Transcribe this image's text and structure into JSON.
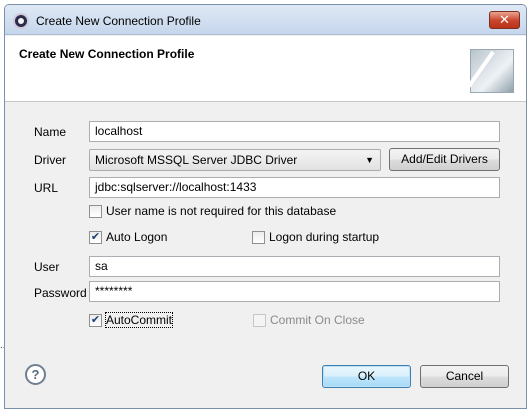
{
  "window": {
    "title": "Create New Connection Profile",
    "close_glyph": "✕"
  },
  "header": {
    "title": "Create New Connection Profile"
  },
  "form": {
    "name_label": "Name",
    "name_value": "localhost",
    "driver_label": "Driver",
    "driver_value": "Microsoft MSSQL Server JDBC Driver",
    "add_edit_drivers": "Add/Edit Drivers",
    "url_label": "URL",
    "url_value": "jdbc:sqlserver://localhost:1433",
    "username_not_required": {
      "label": "User name is not required for this database",
      "checked": false
    },
    "auto_logon": {
      "label": "Auto Logon",
      "checked": true
    },
    "logon_during_startup": {
      "label": "Logon during startup",
      "checked": false
    },
    "user_label": "User",
    "user_value": "sa",
    "password_label": "Password",
    "password_value": "********",
    "autocommit": {
      "label": "AutoCommit",
      "checked": true
    },
    "commit_on_close": {
      "label": "Commit On Close",
      "checked": false,
      "disabled": true
    }
  },
  "footer": {
    "help_glyph": "?",
    "ok": "OK",
    "cancel": "Cancel"
  },
  "icons": {
    "app": "eclipse-icon",
    "dropdown": "chevron-down-icon",
    "help": "help-icon",
    "header": "connection-wizard-graphic"
  }
}
